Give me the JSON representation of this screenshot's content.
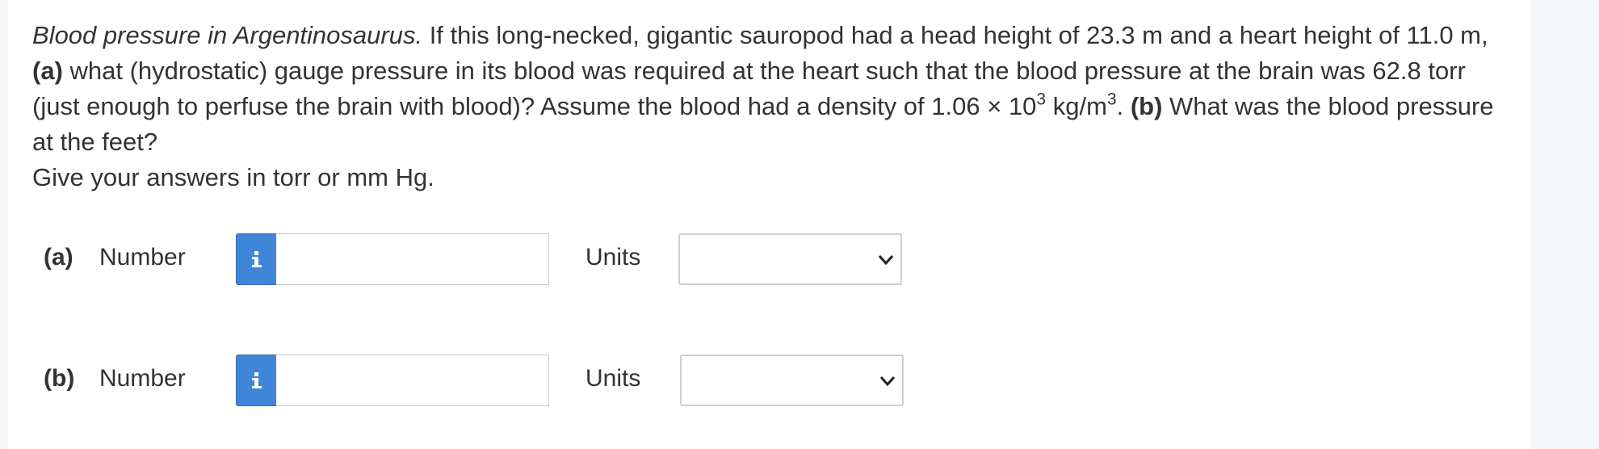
{
  "question": {
    "title": "Blood pressure in Argentinosaurus.",
    "seg1": " If this long-necked, gigantic sauropod had a head height of 23.3 m and a heart height of 11.0 m, ",
    "part_a": "(a)",
    "seg2": " what (hydrostatic) gauge pressure in its blood was required at the heart such that the blood pressure at the brain was 62.8 torr (just enough to perfuse the brain with blood)? Assume the blood had a density of 1.06 × 10",
    "exp1": "3",
    "seg3": " kg/m",
    "exp2": "3",
    "seg4": ". ",
    "part_b": "(b)",
    "seg5": " What was the blood pressure at the feet?",
    "instruction": "Give your answers in torr or mm Hg."
  },
  "answers": [
    {
      "part_label": "(a)",
      "number_label": "Number",
      "info_icon": "i",
      "number_value": "",
      "units_label": "Units",
      "units_selected": ""
    },
    {
      "part_label": "(b)",
      "number_label": "Number",
      "info_icon": "i",
      "number_value": "",
      "units_label": "Units",
      "units_selected": ""
    }
  ],
  "colors": {
    "info_button": "#3f86d8",
    "text": "#333333",
    "page_background": "#f5f6f8",
    "panel_background": "#ffffff"
  }
}
